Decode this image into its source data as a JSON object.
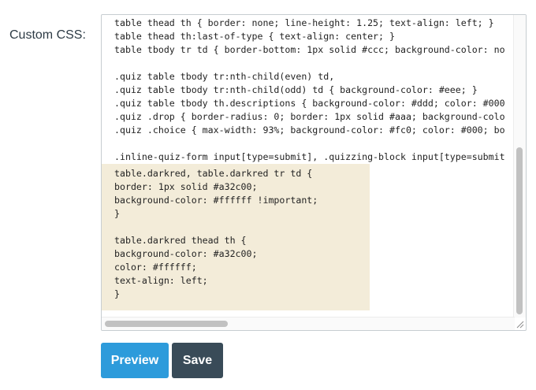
{
  "form": {
    "label": "Custom CSS:",
    "code_lines_top": [
      "table thead th { border: none; line-height: 1.25; text-align: left; }",
      "table thead th:last-of-type { text-align: center; }",
      "table tbody tr td { border-bottom: 1px solid #ccc; background-color: no",
      "",
      ".quiz table tbody tr:nth-child(even) td,",
      ".quiz table tbody tr:nth-child(odd) td { background-color: #eee; }",
      ".quiz table tbody th.descriptions { background-color: #ddd; color: #000",
      ".quiz .drop { border-radius: 0; border: 1px solid #aaa; background-colo",
      ".quiz .choice { max-width: 93%; background-color: #fc0; color: #000; bo",
      "",
      ".inline-quiz-form input[type=submit], .quizzing-block input[type=submit"
    ],
    "code_lines_highlight": [
      "table.darkred, table.darkred tr td {",
      "border: 1px solid #a32c00;",
      "background-color: #ffffff !important;",
      "}",
      "",
      "table.darkred thead th {",
      "background-color: #a32c00;",
      "color: #ffffff;",
      "text-align: left;",
      "}"
    ]
  },
  "buttons": {
    "preview_label": "Preview",
    "save_label": "Save"
  },
  "colors": {
    "preview": "#2d9bdb",
    "save": "#394b58",
    "highlight": "#f3ecd9"
  }
}
